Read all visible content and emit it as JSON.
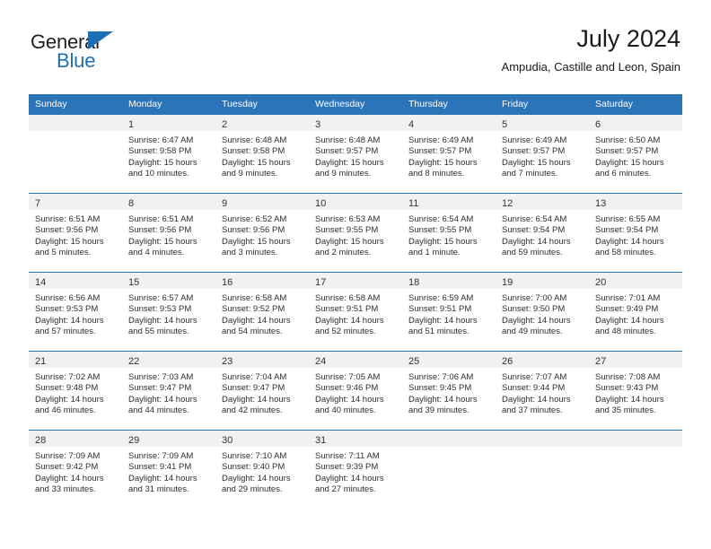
{
  "brand": {
    "name_top": "General",
    "name_bottom": "Blue",
    "accent_color": "#1c6fb5"
  },
  "header": {
    "title": "July 2024",
    "subtitle": "Ampudia, Castille and Leon, Spain"
  },
  "theme": {
    "header_row_color": "#2b74b8",
    "daynum_band_color": "#f1f1f1",
    "text_color": "#2e2e2e"
  },
  "weekdays": [
    "Sunday",
    "Monday",
    "Tuesday",
    "Wednesday",
    "Thursday",
    "Friday",
    "Saturday"
  ],
  "weeks": [
    [
      {
        "day": "",
        "sunrise": "",
        "sunset": "",
        "daylight1": "",
        "daylight2": "",
        "empty": true
      },
      {
        "day": "1",
        "sunrise": "Sunrise: 6:47 AM",
        "sunset": "Sunset: 9:58 PM",
        "daylight1": "Daylight: 15 hours",
        "daylight2": "and 10 minutes."
      },
      {
        "day": "2",
        "sunrise": "Sunrise: 6:48 AM",
        "sunset": "Sunset: 9:58 PM",
        "daylight1": "Daylight: 15 hours",
        "daylight2": "and 9 minutes."
      },
      {
        "day": "3",
        "sunrise": "Sunrise: 6:48 AM",
        "sunset": "Sunset: 9:57 PM",
        "daylight1": "Daylight: 15 hours",
        "daylight2": "and 9 minutes."
      },
      {
        "day": "4",
        "sunrise": "Sunrise: 6:49 AM",
        "sunset": "Sunset: 9:57 PM",
        "daylight1": "Daylight: 15 hours",
        "daylight2": "and 8 minutes."
      },
      {
        "day": "5",
        "sunrise": "Sunrise: 6:49 AM",
        "sunset": "Sunset: 9:57 PM",
        "daylight1": "Daylight: 15 hours",
        "daylight2": "and 7 minutes."
      },
      {
        "day": "6",
        "sunrise": "Sunrise: 6:50 AM",
        "sunset": "Sunset: 9:57 PM",
        "daylight1": "Daylight: 15 hours",
        "daylight2": "and 6 minutes."
      }
    ],
    [
      {
        "day": "7",
        "sunrise": "Sunrise: 6:51 AM",
        "sunset": "Sunset: 9:56 PM",
        "daylight1": "Daylight: 15 hours",
        "daylight2": "and 5 minutes."
      },
      {
        "day": "8",
        "sunrise": "Sunrise: 6:51 AM",
        "sunset": "Sunset: 9:56 PM",
        "daylight1": "Daylight: 15 hours",
        "daylight2": "and 4 minutes."
      },
      {
        "day": "9",
        "sunrise": "Sunrise: 6:52 AM",
        "sunset": "Sunset: 9:56 PM",
        "daylight1": "Daylight: 15 hours",
        "daylight2": "and 3 minutes."
      },
      {
        "day": "10",
        "sunrise": "Sunrise: 6:53 AM",
        "sunset": "Sunset: 9:55 PM",
        "daylight1": "Daylight: 15 hours",
        "daylight2": "and 2 minutes."
      },
      {
        "day": "11",
        "sunrise": "Sunrise: 6:54 AM",
        "sunset": "Sunset: 9:55 PM",
        "daylight1": "Daylight: 15 hours",
        "daylight2": "and 1 minute."
      },
      {
        "day": "12",
        "sunrise": "Sunrise: 6:54 AM",
        "sunset": "Sunset: 9:54 PM",
        "daylight1": "Daylight: 14 hours",
        "daylight2": "and 59 minutes."
      },
      {
        "day": "13",
        "sunrise": "Sunrise: 6:55 AM",
        "sunset": "Sunset: 9:54 PM",
        "daylight1": "Daylight: 14 hours",
        "daylight2": "and 58 minutes."
      }
    ],
    [
      {
        "day": "14",
        "sunrise": "Sunrise: 6:56 AM",
        "sunset": "Sunset: 9:53 PM",
        "daylight1": "Daylight: 14 hours",
        "daylight2": "and 57 minutes."
      },
      {
        "day": "15",
        "sunrise": "Sunrise: 6:57 AM",
        "sunset": "Sunset: 9:53 PM",
        "daylight1": "Daylight: 14 hours",
        "daylight2": "and 55 minutes."
      },
      {
        "day": "16",
        "sunrise": "Sunrise: 6:58 AM",
        "sunset": "Sunset: 9:52 PM",
        "daylight1": "Daylight: 14 hours",
        "daylight2": "and 54 minutes."
      },
      {
        "day": "17",
        "sunrise": "Sunrise: 6:58 AM",
        "sunset": "Sunset: 9:51 PM",
        "daylight1": "Daylight: 14 hours",
        "daylight2": "and 52 minutes."
      },
      {
        "day": "18",
        "sunrise": "Sunrise: 6:59 AM",
        "sunset": "Sunset: 9:51 PM",
        "daylight1": "Daylight: 14 hours",
        "daylight2": "and 51 minutes."
      },
      {
        "day": "19",
        "sunrise": "Sunrise: 7:00 AM",
        "sunset": "Sunset: 9:50 PM",
        "daylight1": "Daylight: 14 hours",
        "daylight2": "and 49 minutes."
      },
      {
        "day": "20",
        "sunrise": "Sunrise: 7:01 AM",
        "sunset": "Sunset: 9:49 PM",
        "daylight1": "Daylight: 14 hours",
        "daylight2": "and 48 minutes."
      }
    ],
    [
      {
        "day": "21",
        "sunrise": "Sunrise: 7:02 AM",
        "sunset": "Sunset: 9:48 PM",
        "daylight1": "Daylight: 14 hours",
        "daylight2": "and 46 minutes."
      },
      {
        "day": "22",
        "sunrise": "Sunrise: 7:03 AM",
        "sunset": "Sunset: 9:47 PM",
        "daylight1": "Daylight: 14 hours",
        "daylight2": "and 44 minutes."
      },
      {
        "day": "23",
        "sunrise": "Sunrise: 7:04 AM",
        "sunset": "Sunset: 9:47 PM",
        "daylight1": "Daylight: 14 hours",
        "daylight2": "and 42 minutes."
      },
      {
        "day": "24",
        "sunrise": "Sunrise: 7:05 AM",
        "sunset": "Sunset: 9:46 PM",
        "daylight1": "Daylight: 14 hours",
        "daylight2": "and 40 minutes."
      },
      {
        "day": "25",
        "sunrise": "Sunrise: 7:06 AM",
        "sunset": "Sunset: 9:45 PM",
        "daylight1": "Daylight: 14 hours",
        "daylight2": "and 39 minutes."
      },
      {
        "day": "26",
        "sunrise": "Sunrise: 7:07 AM",
        "sunset": "Sunset: 9:44 PM",
        "daylight1": "Daylight: 14 hours",
        "daylight2": "and 37 minutes."
      },
      {
        "day": "27",
        "sunrise": "Sunrise: 7:08 AM",
        "sunset": "Sunset: 9:43 PM",
        "daylight1": "Daylight: 14 hours",
        "daylight2": "and 35 minutes."
      }
    ],
    [
      {
        "day": "28",
        "sunrise": "Sunrise: 7:09 AM",
        "sunset": "Sunset: 9:42 PM",
        "daylight1": "Daylight: 14 hours",
        "daylight2": "and 33 minutes."
      },
      {
        "day": "29",
        "sunrise": "Sunrise: 7:09 AM",
        "sunset": "Sunset: 9:41 PM",
        "daylight1": "Daylight: 14 hours",
        "daylight2": "and 31 minutes."
      },
      {
        "day": "30",
        "sunrise": "Sunrise: 7:10 AM",
        "sunset": "Sunset: 9:40 PM",
        "daylight1": "Daylight: 14 hours",
        "daylight2": "and 29 minutes."
      },
      {
        "day": "31",
        "sunrise": "Sunrise: 7:11 AM",
        "sunset": "Sunset: 9:39 PM",
        "daylight1": "Daylight: 14 hours",
        "daylight2": "and 27 minutes."
      },
      {
        "day": "",
        "sunrise": "",
        "sunset": "",
        "daylight1": "",
        "daylight2": "",
        "empty": true
      },
      {
        "day": "",
        "sunrise": "",
        "sunset": "",
        "daylight1": "",
        "daylight2": "",
        "empty": true
      },
      {
        "day": "",
        "sunrise": "",
        "sunset": "",
        "daylight1": "",
        "daylight2": "",
        "empty": true
      }
    ]
  ]
}
